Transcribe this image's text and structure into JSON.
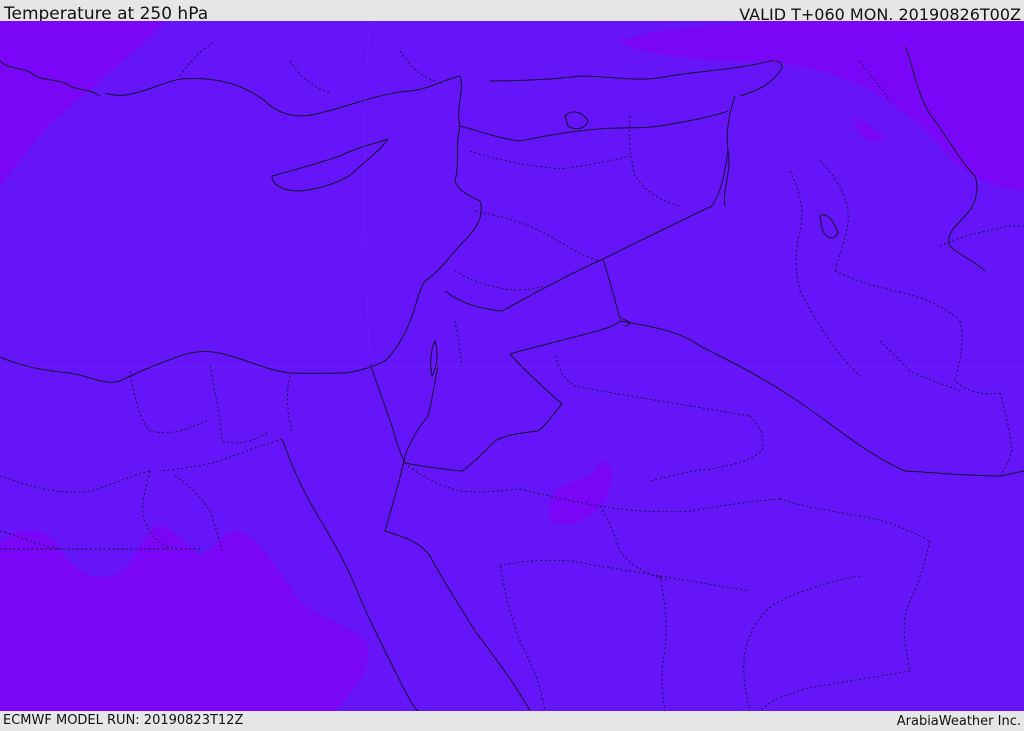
{
  "header": {
    "title": "Temperature at 250 hPa",
    "valid": "VALID T+060 MON. 20190826T00Z"
  },
  "footer": {
    "model_run": "ECMWF MODEL RUN: 20190823T12Z",
    "brand": "ArabiaWeather Inc."
  },
  "colors": {
    "base_fill": "#6515f8",
    "cold_fill": "#7a06f8",
    "coast": "#111133",
    "border": "#111133"
  }
}
